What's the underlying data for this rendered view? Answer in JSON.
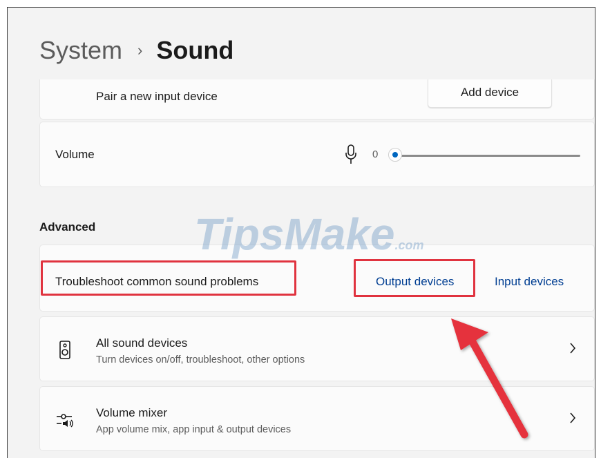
{
  "breadcrumb": {
    "parent": "System",
    "separator": "›",
    "current": "Sound"
  },
  "pair": {
    "label": "Pair a new input device",
    "button": "Add device"
  },
  "volume": {
    "label": "Volume",
    "value_text": "0",
    "value": 0,
    "icon": "microphone-icon"
  },
  "advanced": {
    "title": "Advanced",
    "troubleshoot_label": "Troubleshoot common sound problems",
    "output_link": "Output devices",
    "input_link": "Input devices"
  },
  "rows": [
    {
      "title": "All sound devices",
      "subtitle": "Turn devices on/off, troubleshoot, other options",
      "icon": "speaker-icon"
    },
    {
      "title": "Volume mixer",
      "subtitle": "App volume mix, app input & output devices",
      "icon": "mixer-icon"
    }
  ],
  "watermark": {
    "main": "TipsMake",
    "suffix": ".com"
  },
  "colors": {
    "accent": "#0067c0",
    "link": "#003e92",
    "highlight": "#e0333f",
    "background": "#f3f3f3"
  }
}
